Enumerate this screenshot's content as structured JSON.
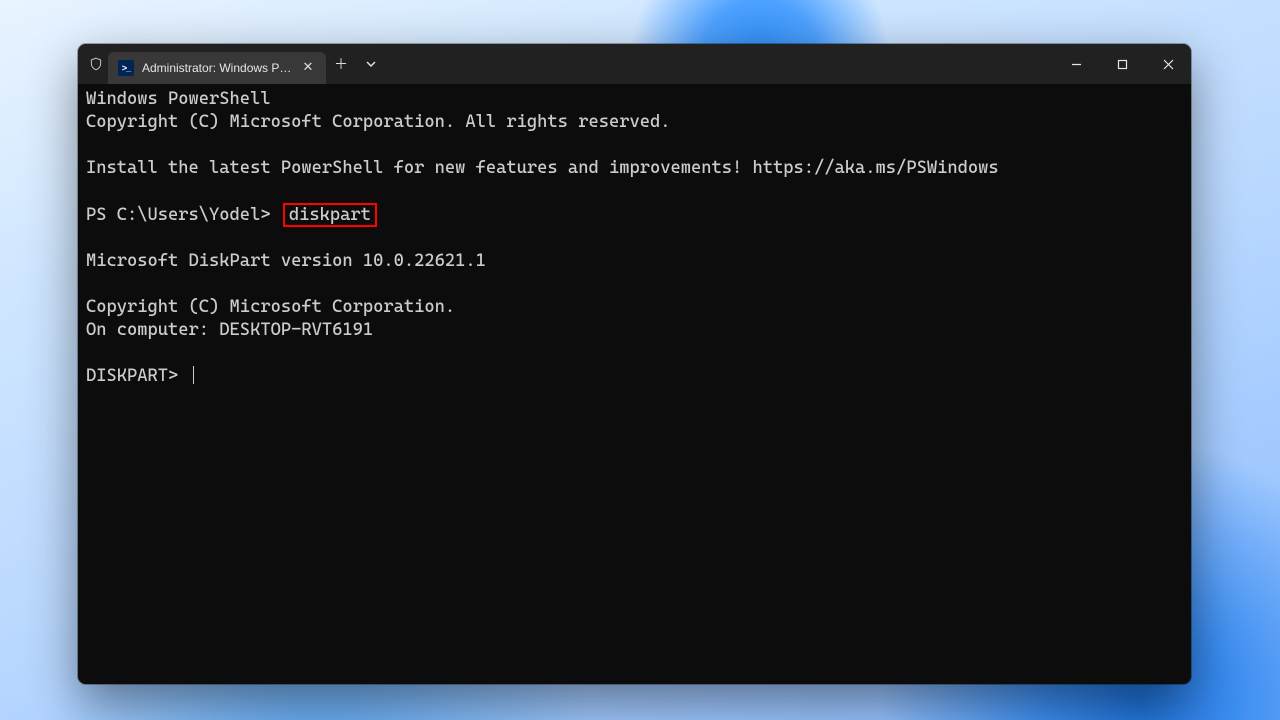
{
  "tab": {
    "title": "Administrator: Windows Powe",
    "icon_text": ">_"
  },
  "terminal": {
    "line1": "Windows PowerShell",
    "line2": "Copyright (C) Microsoft Corporation. All rights reserved.",
    "install_line": "Install the latest PowerShell for new features and improvements! https://aka.ms/PSWindows",
    "prompt_prefix": "PS C:\\Users\\Yodel> ",
    "prompt_command": "diskpart",
    "diskpart_version": "Microsoft DiskPart version 10.0.22621.1",
    "diskpart_copyright": "Copyright (C) Microsoft Corporation.",
    "diskpart_computer": "On computer: DESKTOP-RVT6191",
    "diskpart_prompt": "DISKPART> "
  }
}
